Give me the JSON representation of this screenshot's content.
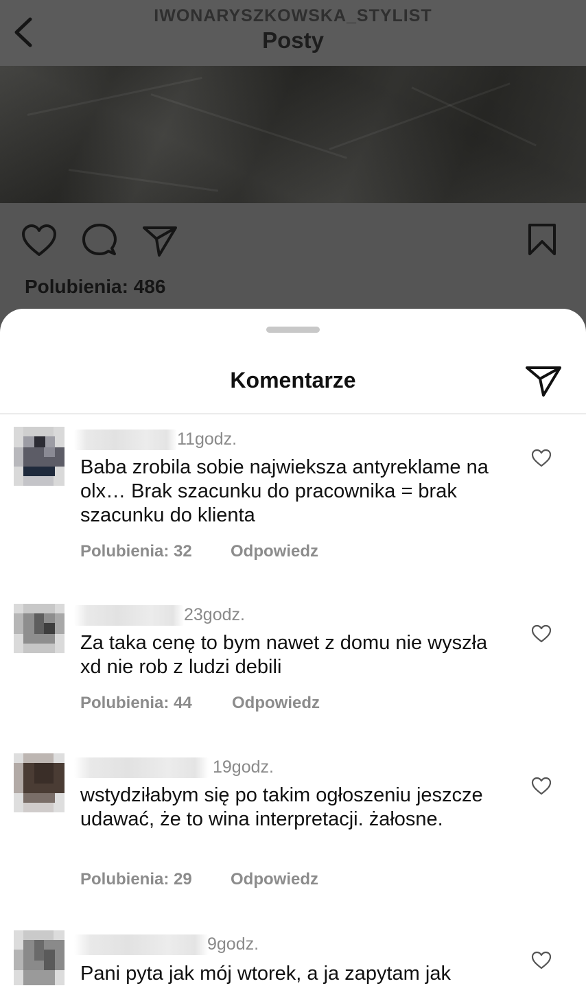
{
  "header": {
    "account_name": "IWONARYSZKOWSKA_STYLIST",
    "title": "Posty"
  },
  "post": {
    "likes_text": "Polubienia: 486"
  },
  "comments_sheet": {
    "title": "Komentarze"
  },
  "comments": [
    {
      "time": "11godz.",
      "text": "Baba zrobila sobie najwieksza antyreklame na olx… Brak szacunku do pracownika = brak szacunku do klienta",
      "likes": "Polubienia: 32",
      "reply_label": "Odpowiedz"
    },
    {
      "time": "23godz.",
      "text": "Za taka cenę to bym nawet z domu nie wyszła xd nie rob z ludzi debili",
      "likes": "Polubienia: 44",
      "reply_label": "Odpowiedz"
    },
    {
      "time": "19godz.",
      "text": "wstydziłabym się po takim ogłoszeniu jeszcze udawać, że to wina interpretacji. żałosne.",
      "likes": "Polubienia: 29",
      "reply_label": "Odpowiedz"
    },
    {
      "time": "9godz.",
      "text": "Pani pyta jak mój wtorek, a ja zapytam jak"
    }
  ],
  "icons": {
    "back": "chevron-left-icon",
    "like": "heart-icon",
    "comment": "speech-bubble-icon",
    "share": "paper-plane-icon",
    "save": "bookmark-icon"
  },
  "colors": {
    "dim_overlay": "#555555",
    "sheet_background": "#ffffff",
    "secondary_text": "#8c8c8c"
  }
}
